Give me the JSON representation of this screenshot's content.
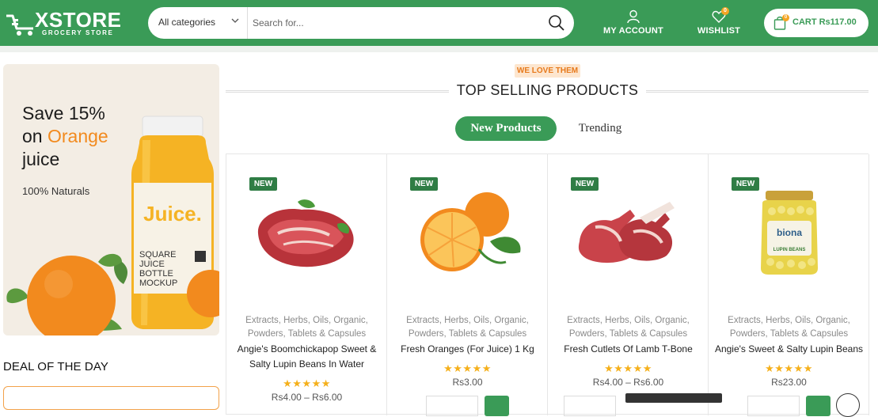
{
  "header": {
    "logo_title": "XSTORE",
    "logo_subtitle": "GROCERY STORE",
    "category_select": "All categories",
    "search_placeholder": "Search for...",
    "account_label": "MY ACCOUNT",
    "wishlist_label": "WISHLIST",
    "wishlist_count": "0",
    "cart_label": "CART Rs117.00",
    "cart_count": "0"
  },
  "sidebar": {
    "promo_line1": "Save 15%",
    "promo_on": "on ",
    "promo_orange": "Orange",
    "promo_line3": "juice",
    "promo_sub": "100% Naturals",
    "jar_label": "Juice.",
    "jar_text": "SQUARE JUICE BOTTLE MOCKUP",
    "deal_title": "DEAL OF THE DAY"
  },
  "main": {
    "tag": "WE LOVE THEM",
    "title": "TOP SELLING PRODUCTS",
    "tabs": [
      {
        "label": "New Products",
        "active": true
      },
      {
        "label": "Trending",
        "active": false
      }
    ],
    "products": [
      {
        "badge": "NEW",
        "image": "raw-meat-steak",
        "categories": "Extracts, Herbs, Oils, Organic, Powders, Tablets & Capsules",
        "name": "Angie's Boomchickapop Sweet & Salty Lupin Beans In Water",
        "stars": "★★★★★",
        "price": "Rs4.00 – Rs6.00"
      },
      {
        "badge": "NEW",
        "image": "fresh-oranges",
        "categories": "Extracts, Herbs, Oils, Organic, Powders, Tablets & Capsules",
        "name": "Fresh Oranges (For Juice) 1 Kg",
        "stars": "★★★★★",
        "price": "Rs3.00"
      },
      {
        "badge": "NEW",
        "image": "lamb-cutlets",
        "categories": "Extracts, Herbs, Oils, Organic, Powders, Tablets & Capsules",
        "name": "Fresh Cutlets Of Lamb T-Bone",
        "stars": "★★★★★",
        "price": "Rs4.00 – Rs6.00"
      },
      {
        "badge": "NEW",
        "image": "lupin-beans-jar",
        "categories": "Extracts, Herbs, Oils, Organic, Powders, Tablets & Capsules",
        "name": "Angie's Sweet & Salty Lupin Beans",
        "stars": "★★★★★",
        "price": "Rs23.00",
        "jar_brand": "biona",
        "jar_label": "LUPIN BEANS"
      }
    ]
  },
  "colors": {
    "brand_green": "#3a9b57",
    "accent_orange": "#f28a1e",
    "star": "#f5b01b"
  }
}
